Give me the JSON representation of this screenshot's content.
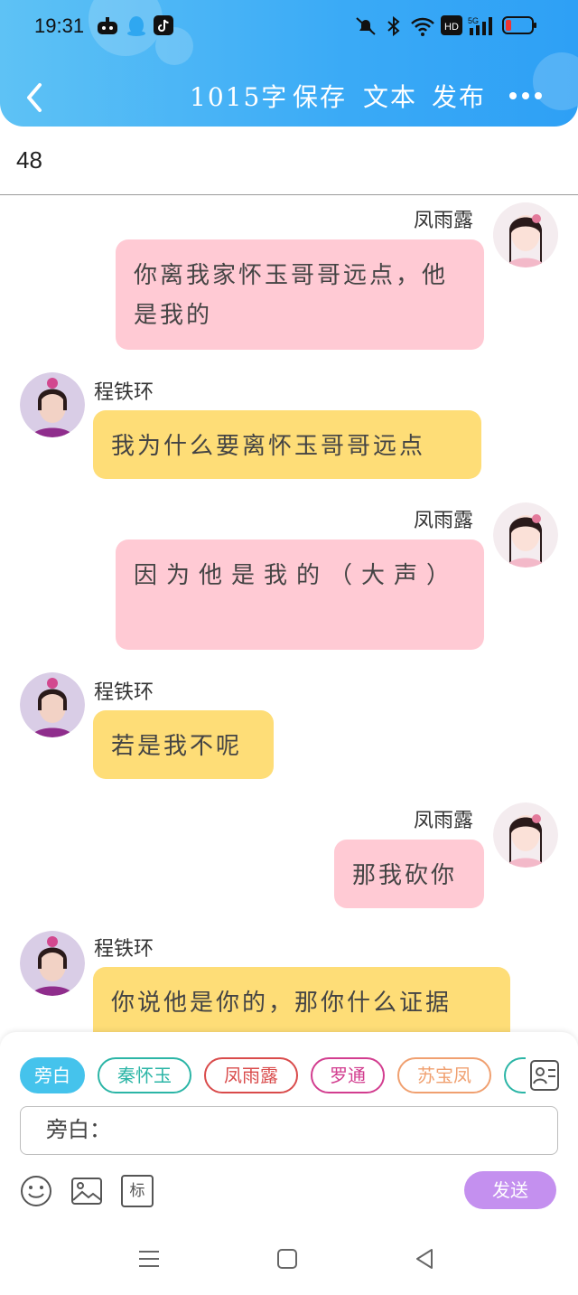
{
  "status_bar": {
    "time": "19:31",
    "network": "5G"
  },
  "header": {
    "word_count": "1015字",
    "save": "保存",
    "text": "文本",
    "publish": "发布"
  },
  "chapter_number": "48",
  "messages": [
    {
      "speaker": "凤雨露",
      "text": "你离我家怀玉哥哥远点，他是我的"
    },
    {
      "speaker": "程铁环",
      "text": "我为什么要离怀玉哥哥远点"
    },
    {
      "speaker": "凤雨露",
      "text": "因为他是我的（大声）"
    },
    {
      "speaker": "程铁环",
      "text": "若是我不呢"
    },
    {
      "speaker": "凤雨露",
      "text": "那我砍你"
    },
    {
      "speaker": "程铁环",
      "text": "你说他是你的，那你什么证据"
    }
  ],
  "characters": [
    "旁白",
    "秦怀玉",
    "凤雨露",
    "罗通",
    "苏宝凤"
  ],
  "character_colors": {
    "旁白": "#45c3ec",
    "秦怀玉": "#2bb5a6",
    "凤雨露": "#d94b4b",
    "罗通": "#d23d8f",
    "苏宝凤": "#f0a070"
  },
  "input": {
    "value": "旁白："
  },
  "tools": {
    "tag_label": "标"
  },
  "send_label": "发送"
}
